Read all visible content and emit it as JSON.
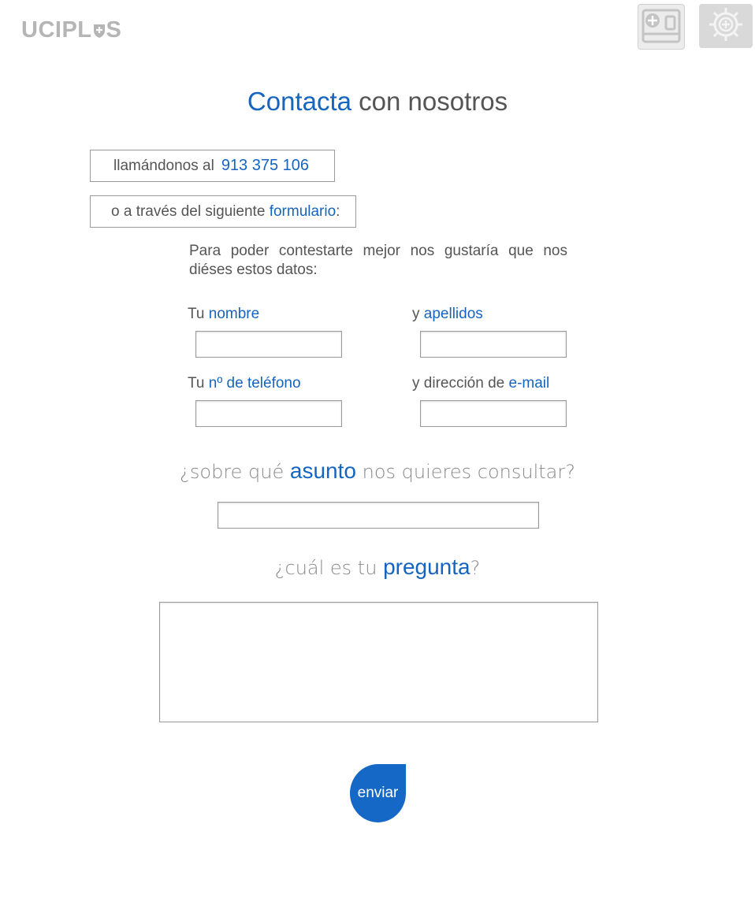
{
  "header": {
    "logo_prefix": "UCIPL",
    "logo_suffix": "S",
    "buttons": [
      {
        "icon": "tablet-plus-icon"
      },
      {
        "icon": "gear-plus-icon"
      }
    ]
  },
  "title": {
    "highlight": "Contacta",
    "rest": " con nosotros"
  },
  "phone": {
    "label": "llamándonos al",
    "number": "913 375 106"
  },
  "form_intro": {
    "prefix": "o a través del siguiente ",
    "highlight": "formulario",
    "suffix": ":"
  },
  "intro_text": "Para poder contestarte mejor nos gustaría que nos diéses estos datos:",
  "fields": {
    "name": {
      "prefix": "Tu ",
      "highlight": "nombre",
      "value": ""
    },
    "surname": {
      "prefix": "y ",
      "highlight": "apellidos",
      "value": ""
    },
    "phone": {
      "prefix": "Tu ",
      "highlight": "nº de teléfono",
      "value": ""
    },
    "email": {
      "prefix": "y dirección de ",
      "highlight": "e-mail",
      "value": ""
    }
  },
  "subject": {
    "prefix": "¿sobre qué ",
    "highlight": "asunto",
    "suffix": " nos quieres consultar?",
    "value": ""
  },
  "question": {
    "prefix": "¿cuál es tu ",
    "highlight": "pregunta",
    "suffix": "?",
    "value": ""
  },
  "submit_label": "enviar",
  "colors": {
    "accent": "#1565c0",
    "button": "#1668c7",
    "logo": "#b5b5b5"
  }
}
